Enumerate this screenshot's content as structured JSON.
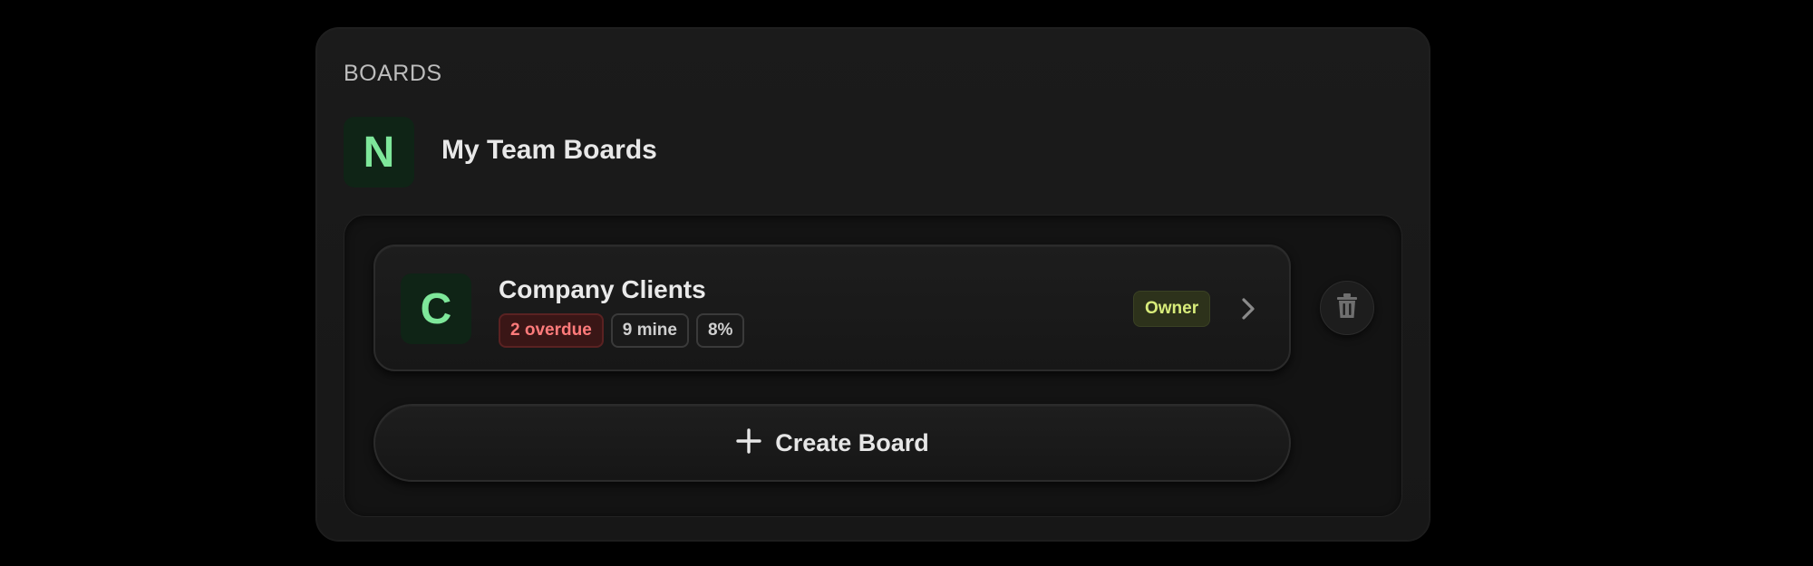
{
  "section": {
    "label": "BOARDS"
  },
  "team": {
    "initial": "N",
    "title": "My Team Boards"
  },
  "boards": [
    {
      "initial": "C",
      "name": "Company Clients",
      "chips": {
        "overdue": "2 overdue",
        "mine": "9 mine",
        "progress": "8%"
      },
      "role": "Owner"
    }
  ],
  "actions": {
    "create_label": "Create Board"
  },
  "icons": {
    "chevron": "chevron-right-icon",
    "delete": "trash-icon",
    "create": "plus-icon"
  },
  "colors": {
    "accent_green": "#7ee79a",
    "overdue_red": "#ff7b7b",
    "owner_yellow": "#d8ec7a"
  }
}
